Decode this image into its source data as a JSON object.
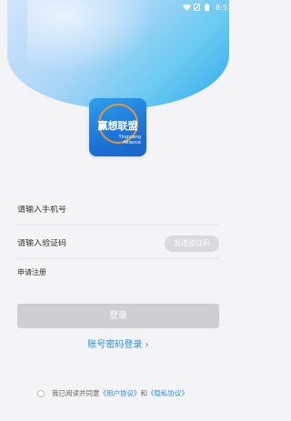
{
  "status_bar": {
    "time": "8:57"
  },
  "logo": {
    "title": "赢想联盟",
    "subtitle_line1": "Yingxiang",
    "subtitle_line2": "Alliance"
  },
  "form": {
    "phone_placeholder": "请输入手机号",
    "code_placeholder": "请输入验证码",
    "send_code_label": "发送验证码",
    "register_label": "申请注册",
    "login_label": "登录",
    "password_login_label": "账号密码登录 ›"
  },
  "agreement": {
    "prefix": "我已阅读并同意",
    "user_agreement": "《用户协议》",
    "and": "和",
    "privacy_agreement": "《隐私协议》"
  },
  "colors": {
    "accent": "#1e90e8",
    "button_disabled": "#cfcfd3",
    "background": "#f4f4f6"
  }
}
